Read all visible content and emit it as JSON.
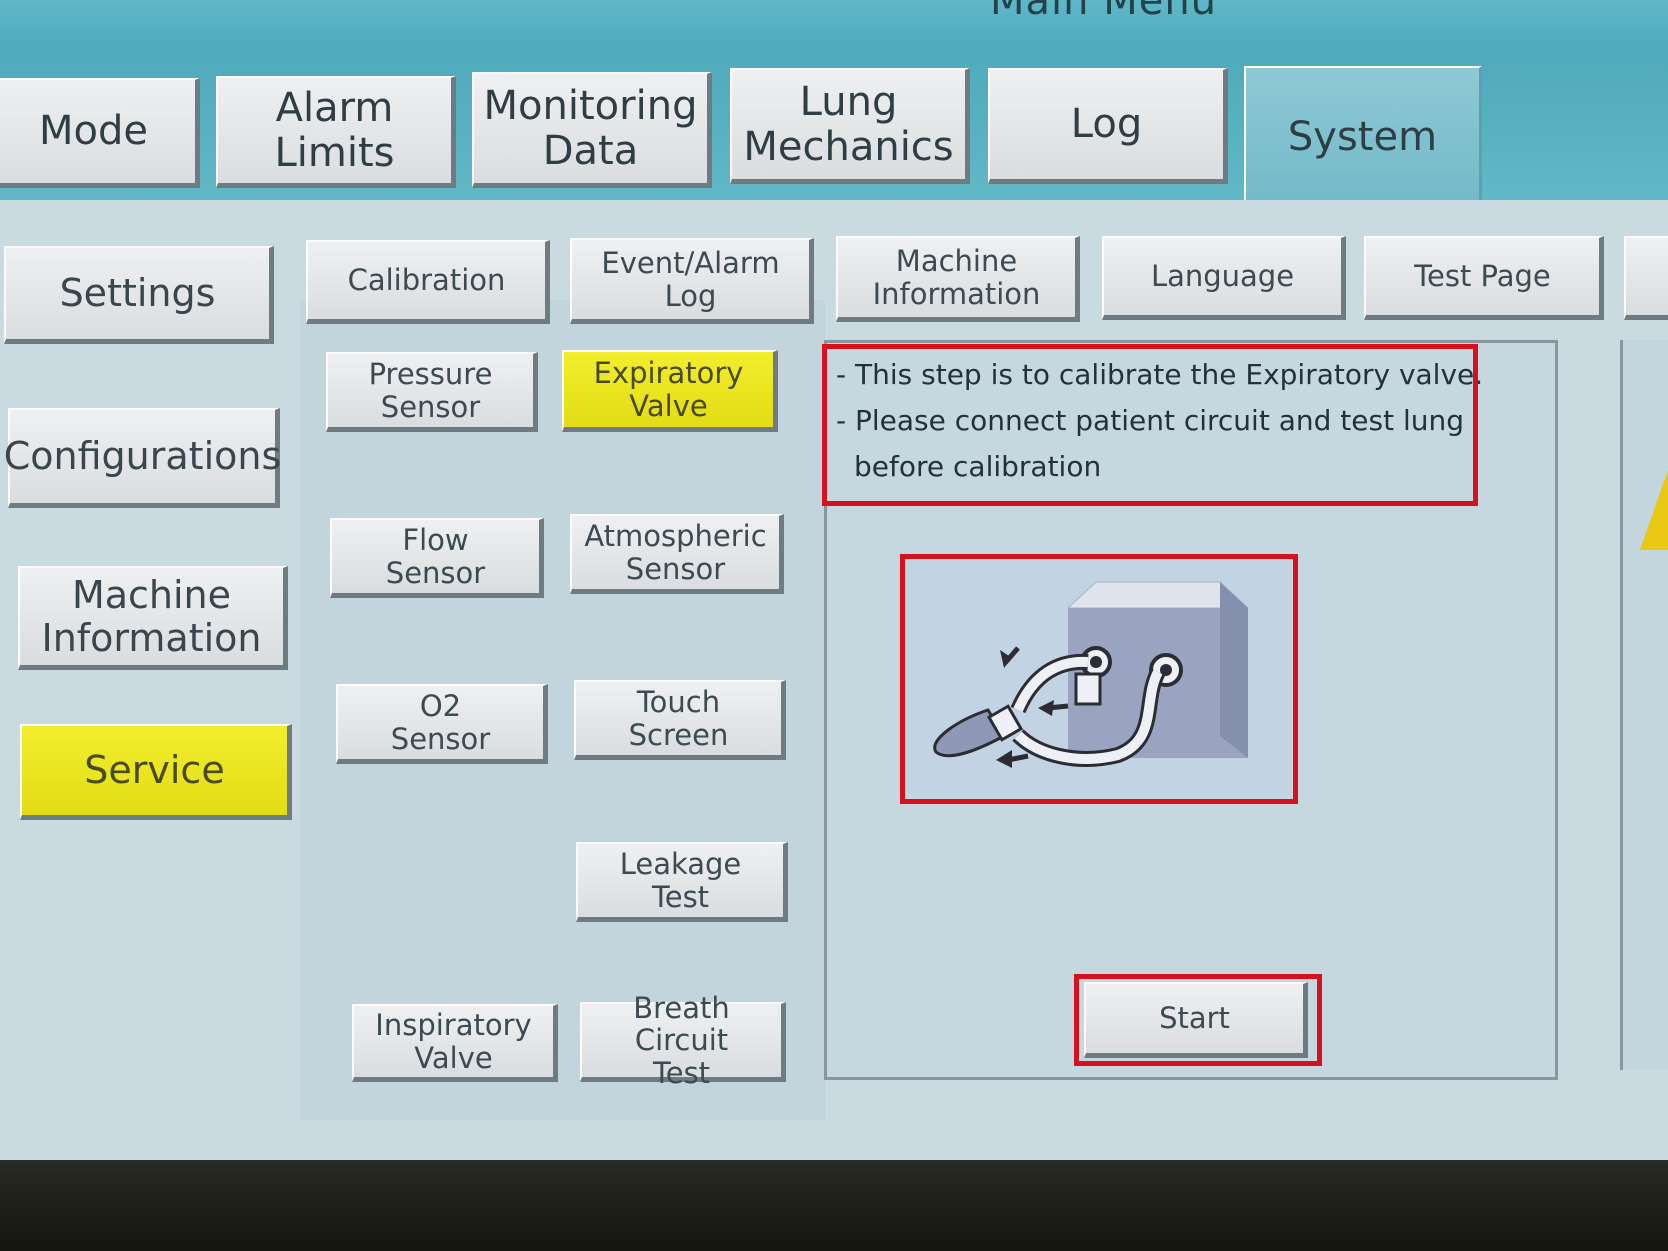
{
  "title": "Main Menu",
  "tabs": [
    {
      "label": "Mode",
      "active": false
    },
    {
      "label": "Alarm\nLimits",
      "active": false
    },
    {
      "label": "Monitoring\nData",
      "active": false
    },
    {
      "label": "Lung\nMechanics",
      "active": false
    },
    {
      "label": "Log",
      "active": false
    },
    {
      "label": "System",
      "active": true
    }
  ],
  "side_menu": [
    {
      "label": "Settings",
      "active": false
    },
    {
      "label": "Configurations",
      "active": false
    },
    {
      "label": "Machine\nInformation",
      "active": false
    },
    {
      "label": "Service",
      "active": true
    }
  ],
  "sub_tabs": [
    {
      "label": "Calibration"
    },
    {
      "label": "Event/Alarm\nLog"
    },
    {
      "label": "Machine\nInformation"
    },
    {
      "label": "Language"
    },
    {
      "label": "Test Page"
    }
  ],
  "service_buttons": [
    {
      "label": "Pressure\nSensor",
      "active": false
    },
    {
      "label": "Expiratory\nValve",
      "active": true
    },
    {
      "label": "Flow\nSensor",
      "active": false
    },
    {
      "label": "Atmospheric\nSensor",
      "active": false
    },
    {
      "label": "O2\nSensor",
      "active": false
    },
    {
      "label": "Touch\nScreen",
      "active": false
    },
    {
      "label": "Leakage\nTest",
      "active": false
    },
    {
      "label": "Inspiratory\nValve",
      "active": false
    },
    {
      "label": "Breath Circuit\nTest",
      "active": false
    }
  ],
  "instructions": {
    "line1": "- This step is to calibrate the Expiratory valve.",
    "line2": "- Please connect patient circuit and test lung",
    "line3": "before calibration"
  },
  "start_label": "Start",
  "colors": {
    "highlight": "#e8e21f",
    "annotation": "#d4111c",
    "tab_bar": "#4faabb"
  },
  "icons": {
    "illustration": "patient-circuit-test-lung-illustration",
    "warning": "warning-triangle-icon"
  }
}
